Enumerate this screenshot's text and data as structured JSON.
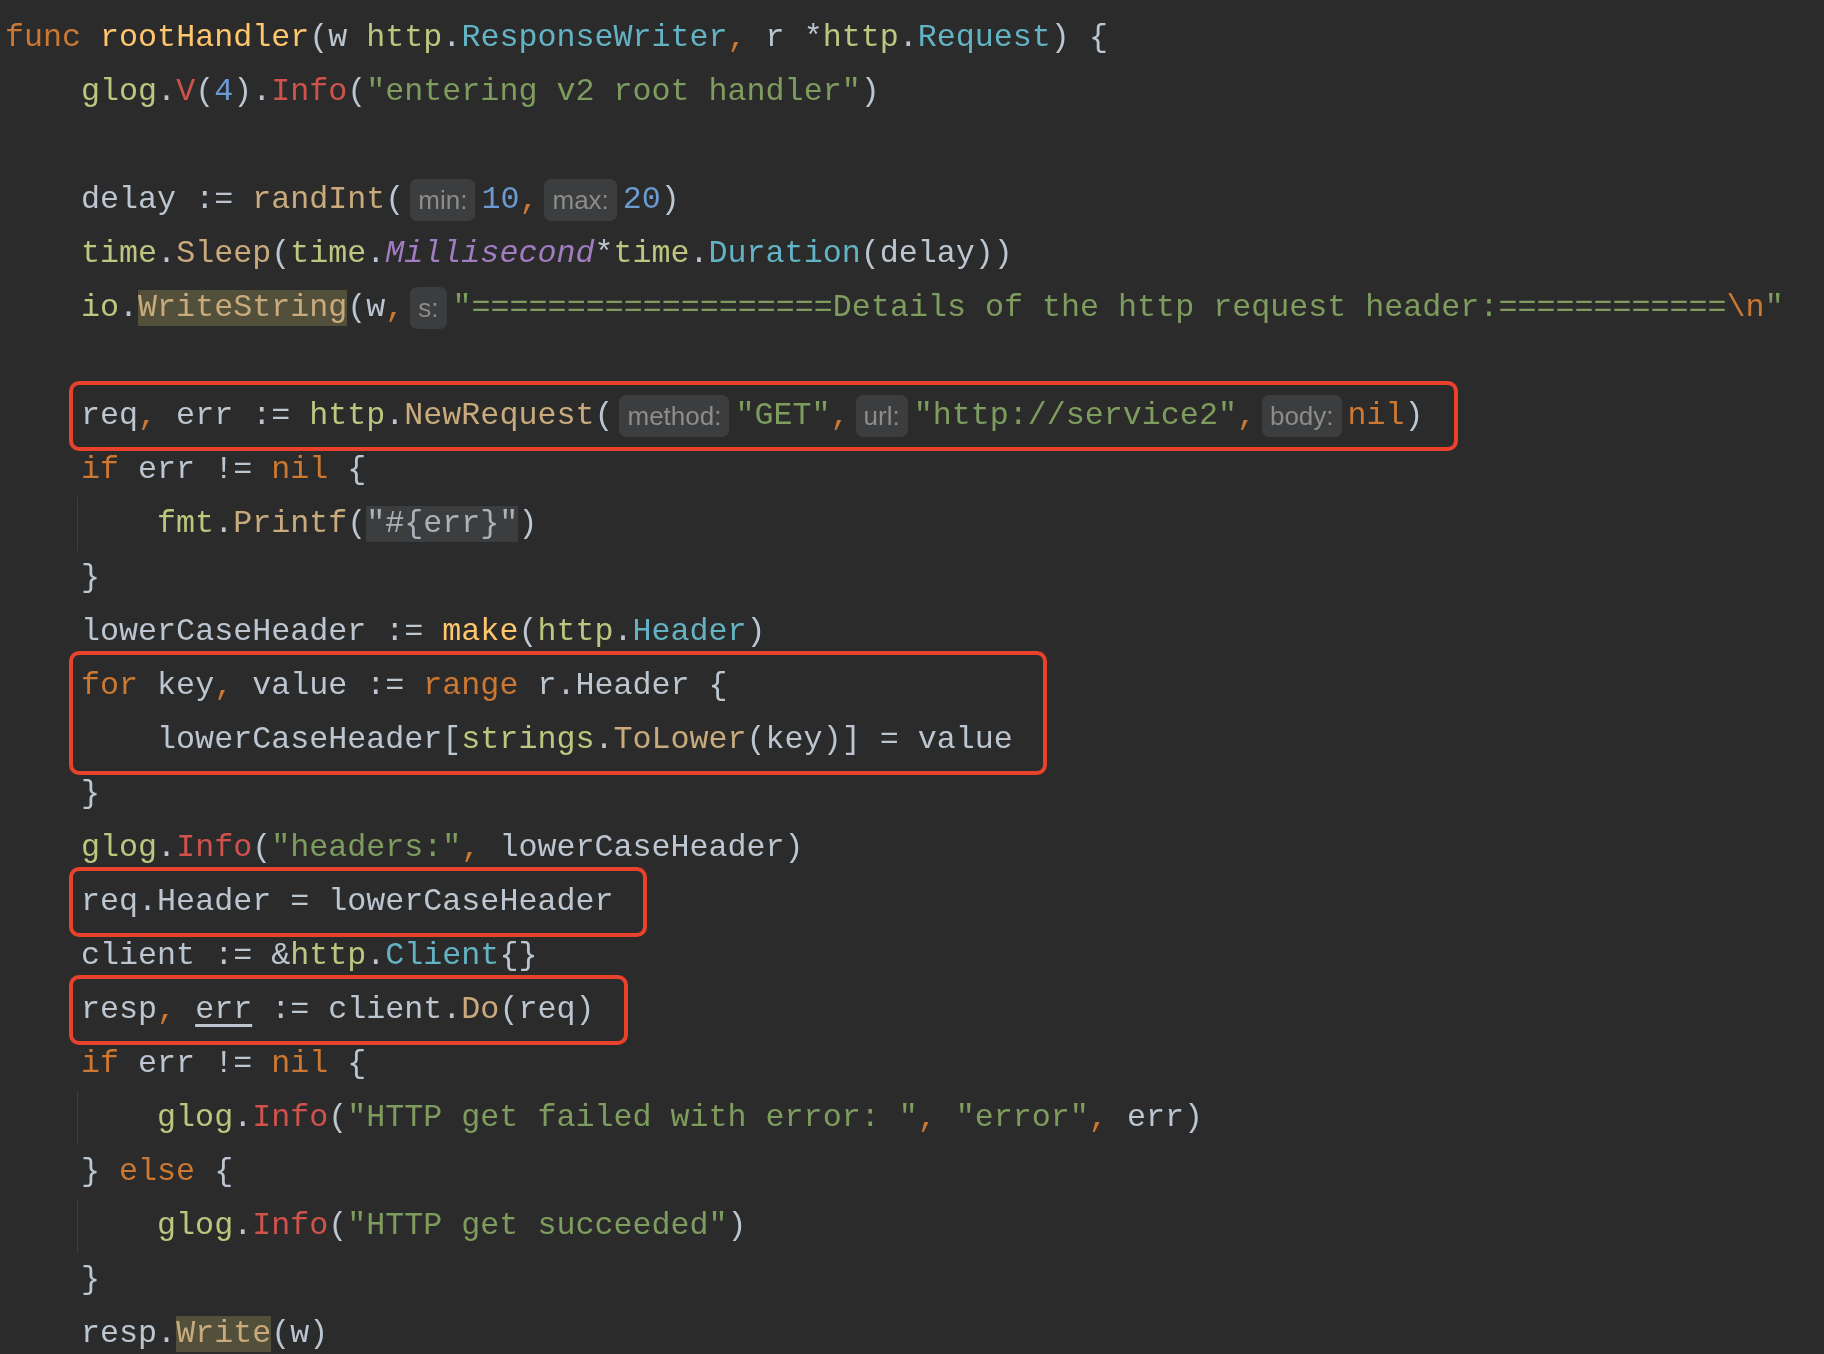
{
  "editor": {
    "lines": [
      {
        "kind": "code",
        "parts": [
          {
            "kind": "code",
            "tokens": [
              {
                "kind": "kw",
                "text": "func "
              },
              {
                "kind": "fndecl",
                "text": "rootHandler"
              },
              {
                "kind": "id",
                "text": "(w "
              },
              {
                "kind": "pkg",
                "text": "http"
              },
              {
                "kind": "id",
                "text": "."
              },
              {
                "kind": "type",
                "text": "ResponseWriter"
              },
              {
                "kind": "kw",
                "text": ","
              },
              {
                "kind": "id",
                "text": " r *"
              },
              {
                "kind": "pkg",
                "text": "http"
              },
              {
                "kind": "id",
                "text": "."
              },
              {
                "kind": "type",
                "text": "Request"
              },
              {
                "kind": "id",
                "text": ") {"
              }
            ]
          }
        ],
        "children": [
          {
            "kind": "code",
            "parts": [
              {
                "kind": "code",
                "tokens": [
                  {
                    "kind": "pkg",
                    "text": "glog"
                  },
                  {
                    "kind": "id",
                    "text": "."
                  },
                  {
                    "kind": "log",
                    "text": "V"
                  },
                  {
                    "kind": "id",
                    "text": "("
                  },
                  {
                    "kind": "num",
                    "text": "4"
                  },
                  {
                    "kind": "id",
                    "text": ")."
                  },
                  {
                    "kind": "log",
                    "text": "Info"
                  },
                  {
                    "kind": "id",
                    "text": "("
                  },
                  {
                    "kind": "str",
                    "text": "\"entering v2 root handler\""
                  },
                  {
                    "kind": "id",
                    "text": ")"
                  }
                ]
              }
            ]
          },
          {
            "kind": "blank"
          },
          {
            "kind": "code",
            "parts": [
              {
                "kind": "code",
                "tokens": [
                  {
                    "kind": "id",
                    "text": "delay := "
                  },
                  {
                    "kind": "call",
                    "text": "randInt"
                  },
                  {
                    "kind": "id",
                    "text": "("
                  }
                ]
              },
              {
                "kind": "hint",
                "text": "min:"
              },
              {
                "kind": "code",
                "tokens": [
                  {
                    "kind": "num",
                    "text": "10"
                  },
                  {
                    "kind": "kw",
                    "text": ","
                  }
                ]
              },
              {
                "kind": "hint",
                "text": "max:"
              },
              {
                "kind": "code",
                "tokens": [
                  {
                    "kind": "num",
                    "text": "20"
                  },
                  {
                    "kind": "id",
                    "text": ")"
                  }
                ]
              }
            ]
          },
          {
            "kind": "code",
            "parts": [
              {
                "kind": "code",
                "tokens": [
                  {
                    "kind": "pkg",
                    "text": "time"
                  },
                  {
                    "kind": "id",
                    "text": "."
                  },
                  {
                    "kind": "call",
                    "text": "Sleep"
                  },
                  {
                    "kind": "id",
                    "text": "("
                  },
                  {
                    "kind": "pkg",
                    "text": "time"
                  },
                  {
                    "kind": "id",
                    "text": "."
                  },
                  {
                    "kind": "const",
                    "text": "Millisecond"
                  },
                  {
                    "kind": "id",
                    "text": "*"
                  },
                  {
                    "kind": "pkg",
                    "text": "time"
                  },
                  {
                    "kind": "id",
                    "text": "."
                  },
                  {
                    "kind": "type",
                    "text": "Duration"
                  },
                  {
                    "kind": "id",
                    "text": "(delay))"
                  }
                ]
              }
            ]
          },
          {
            "kind": "code",
            "parts": [
              {
                "kind": "code",
                "tokens": [
                  {
                    "kind": "pkg",
                    "text": "io"
                  },
                  {
                    "kind": "id",
                    "text": "."
                  },
                  {
                    "kind": "call",
                    "text": "WriteString",
                    "highlighted": true
                  },
                  {
                    "kind": "id",
                    "text": "(w"
                  },
                  {
                    "kind": "kw",
                    "text": ","
                  }
                ]
              },
              {
                "kind": "hint",
                "text": "s:"
              },
              {
                "kind": "code",
                "tokens": [
                  {
                    "kind": "str",
                    "text": "\"===================Details of the http request header:============"
                  },
                  {
                    "kind": "esc",
                    "text": "\\n"
                  },
                  {
                    "kind": "str",
                    "text": "\""
                  }
                ]
              }
            ]
          },
          {
            "kind": "blank"
          },
          {
            "kind": "code",
            "boxed": true,
            "parts": [
              {
                "kind": "code",
                "tokens": [
                  {
                    "kind": "id",
                    "text": "req"
                  },
                  {
                    "kind": "kw",
                    "text": ","
                  },
                  {
                    "kind": "id",
                    "text": " err := "
                  },
                  {
                    "kind": "pkg",
                    "text": "http"
                  },
                  {
                    "kind": "id",
                    "text": "."
                  },
                  {
                    "kind": "call",
                    "text": "NewRequest"
                  },
                  {
                    "kind": "id",
                    "text": "("
                  }
                ]
              },
              {
                "kind": "hint",
                "text": "method:"
              },
              {
                "kind": "code",
                "tokens": [
                  {
                    "kind": "str",
                    "text": "\"GET\""
                  },
                  {
                    "kind": "kw",
                    "text": ","
                  }
                ]
              },
              {
                "kind": "hint",
                "text": "url:"
              },
              {
                "kind": "code",
                "tokens": [
                  {
                    "kind": "str",
                    "text": "\"http://service2\""
                  },
                  {
                    "kind": "kw",
                    "text": ","
                  }
                ]
              },
              {
                "kind": "hint",
                "text": "body:"
              },
              {
                "kind": "code",
                "tokens": [
                  {
                    "kind": "kw",
                    "text": "nil"
                  },
                  {
                    "kind": "id",
                    "text": ")"
                  }
                ]
              }
            ]
          },
          {
            "kind": "code",
            "parts": [
              {
                "kind": "code",
                "tokens": [
                  {
                    "kind": "kw",
                    "text": "if"
                  },
                  {
                    "kind": "id",
                    "text": " err != "
                  },
                  {
                    "kind": "kw",
                    "text": "nil"
                  },
                  {
                    "kind": "id",
                    "text": " {"
                  }
                ]
              }
            ],
            "children": [
              {
                "kind": "code",
                "parts": [
                  {
                    "kind": "code",
                    "tokens": [
                      {
                        "kind": "pkg",
                        "text": "fmt"
                      },
                      {
                        "kind": "id",
                        "text": "."
                      },
                      {
                        "kind": "call",
                        "text": "Printf"
                      },
                      {
                        "kind": "id",
                        "text": "("
                      },
                      {
                        "kind": "str",
                        "text": "\"#{err}\"",
                        "injected": true
                      },
                      {
                        "kind": "id",
                        "text": ")"
                      }
                    ]
                  }
                ]
              }
            ]
          },
          {
            "kind": "code",
            "parts": [
              {
                "kind": "code",
                "tokens": [
                  {
                    "kind": "id",
                    "text": "}"
                  }
                ]
              }
            ]
          },
          {
            "kind": "code",
            "parts": [
              {
                "kind": "code",
                "tokens": [
                  {
                    "kind": "id",
                    "text": "lowerCaseHeader := "
                  },
                  {
                    "kind": "builtin",
                    "text": "make"
                  },
                  {
                    "kind": "id",
                    "text": "("
                  },
                  {
                    "kind": "pkg",
                    "text": "http"
                  },
                  {
                    "kind": "id",
                    "text": "."
                  },
                  {
                    "kind": "type",
                    "text": "Header"
                  },
                  {
                    "kind": "id",
                    "text": ")"
                  }
                ]
              }
            ]
          },
          {
            "kind": "code",
            "boxed": true,
            "parts": [
              {
                "kind": "code",
                "tokens": [
                  {
                    "kind": "kw",
                    "text": "for"
                  },
                  {
                    "kind": "id",
                    "text": " key"
                  },
                  {
                    "kind": "kw",
                    "text": ","
                  },
                  {
                    "kind": "id",
                    "text": " value := "
                  },
                  {
                    "kind": "kw",
                    "text": "range"
                  },
                  {
                    "kind": "id",
                    "text": " r.Header {"
                  }
                ]
              }
            ],
            "children": [
              {
                "kind": "code",
                "parts": [
                  {
                    "kind": "code",
                    "tokens": [
                      {
                        "kind": "id",
                        "text": "lowerCaseHeader["
                      },
                      {
                        "kind": "pkg",
                        "text": "strings"
                      },
                      {
                        "kind": "id",
                        "text": "."
                      },
                      {
                        "kind": "call",
                        "text": "ToLower"
                      },
                      {
                        "kind": "id",
                        "text": "(key)] = value"
                      }
                    ]
                  }
                ]
              }
            ]
          },
          {
            "kind": "code",
            "parts": [
              {
                "kind": "code",
                "tokens": [
                  {
                    "kind": "id",
                    "text": "}"
                  }
                ]
              }
            ]
          },
          {
            "kind": "code",
            "parts": [
              {
                "kind": "code",
                "tokens": [
                  {
                    "kind": "pkg",
                    "text": "glog"
                  },
                  {
                    "kind": "id",
                    "text": "."
                  },
                  {
                    "kind": "log",
                    "text": "Info"
                  },
                  {
                    "kind": "id",
                    "text": "("
                  },
                  {
                    "kind": "str",
                    "text": "\"headers:\""
                  },
                  {
                    "kind": "kw",
                    "text": ","
                  },
                  {
                    "kind": "id",
                    "text": " lowerCaseHeader)"
                  }
                ]
              }
            ]
          },
          {
            "kind": "code",
            "boxed": true,
            "parts": [
              {
                "kind": "code",
                "tokens": [
                  {
                    "kind": "id",
                    "text": "req.Header = lowerCaseHeader"
                  }
                ]
              }
            ]
          },
          {
            "kind": "code",
            "parts": [
              {
                "kind": "code",
                "tokens": [
                  {
                    "kind": "id",
                    "text": "client := &"
                  },
                  {
                    "kind": "pkg",
                    "text": "http"
                  },
                  {
                    "kind": "id",
                    "text": "."
                  },
                  {
                    "kind": "type",
                    "text": "Client"
                  },
                  {
                    "kind": "id",
                    "text": "{}"
                  }
                ]
              }
            ]
          },
          {
            "kind": "code",
            "boxed": true,
            "parts": [
              {
                "kind": "code",
                "tokens": [
                  {
                    "kind": "id",
                    "text": "resp"
                  },
                  {
                    "kind": "kw",
                    "text": ", "
                  },
                  {
                    "kind": "id",
                    "text": "err",
                    "underlined": true
                  },
                  {
                    "kind": "id",
                    "text": " := client."
                  },
                  {
                    "kind": "call",
                    "text": "Do"
                  },
                  {
                    "kind": "id",
                    "text": "(req)"
                  }
                ]
              }
            ]
          },
          {
            "kind": "code",
            "parts": [
              {
                "kind": "code",
                "tokens": [
                  {
                    "kind": "kw",
                    "text": "if"
                  },
                  {
                    "kind": "id",
                    "text": " err != "
                  },
                  {
                    "kind": "kw",
                    "text": "nil"
                  },
                  {
                    "kind": "id",
                    "text": " {"
                  }
                ]
              }
            ],
            "children": [
              {
                "kind": "code",
                "parts": [
                  {
                    "kind": "code",
                    "tokens": [
                      {
                        "kind": "pkg",
                        "text": "glog"
                      },
                      {
                        "kind": "id",
                        "text": "."
                      },
                      {
                        "kind": "log",
                        "text": "Info"
                      },
                      {
                        "kind": "id",
                        "text": "("
                      },
                      {
                        "kind": "str",
                        "text": "\"HTTP get failed with error: \""
                      },
                      {
                        "kind": "kw",
                        "text": ", "
                      },
                      {
                        "kind": "str",
                        "text": "\"error\""
                      },
                      {
                        "kind": "kw",
                        "text": ","
                      },
                      {
                        "kind": "id",
                        "text": " err)"
                      }
                    ]
                  }
                ]
              }
            ]
          },
          {
            "kind": "code",
            "parts": [
              {
                "kind": "code",
                "tokens": [
                  {
                    "kind": "id",
                    "text": "} "
                  },
                  {
                    "kind": "kw",
                    "text": "else"
                  },
                  {
                    "kind": "id",
                    "text": " {"
                  }
                ]
              }
            ],
            "children": [
              {
                "kind": "code",
                "parts": [
                  {
                    "kind": "code",
                    "tokens": [
                      {
                        "kind": "pkg",
                        "text": "glog"
                      },
                      {
                        "kind": "id",
                        "text": "."
                      },
                      {
                        "kind": "log",
                        "text": "Info"
                      },
                      {
                        "kind": "id",
                        "text": "("
                      },
                      {
                        "kind": "str",
                        "text": "\"HTTP get succeeded\""
                      },
                      {
                        "kind": "id",
                        "text": ")"
                      }
                    ]
                  }
                ]
              }
            ]
          },
          {
            "kind": "code",
            "parts": [
              {
                "kind": "code",
                "tokens": [
                  {
                    "kind": "id",
                    "text": "}"
                  }
                ]
              }
            ]
          },
          {
            "kind": "code",
            "parts": [
              {
                "kind": "code",
                "tokens": [
                  {
                    "kind": "id",
                    "text": "resp."
                  },
                  {
                    "kind": "call",
                    "text": "Write",
                    "highlighted": true
                  },
                  {
                    "kind": "id",
                    "text": "(w)"
                  }
                ]
              }
            ]
          }
        ]
      }
    ]
  }
}
